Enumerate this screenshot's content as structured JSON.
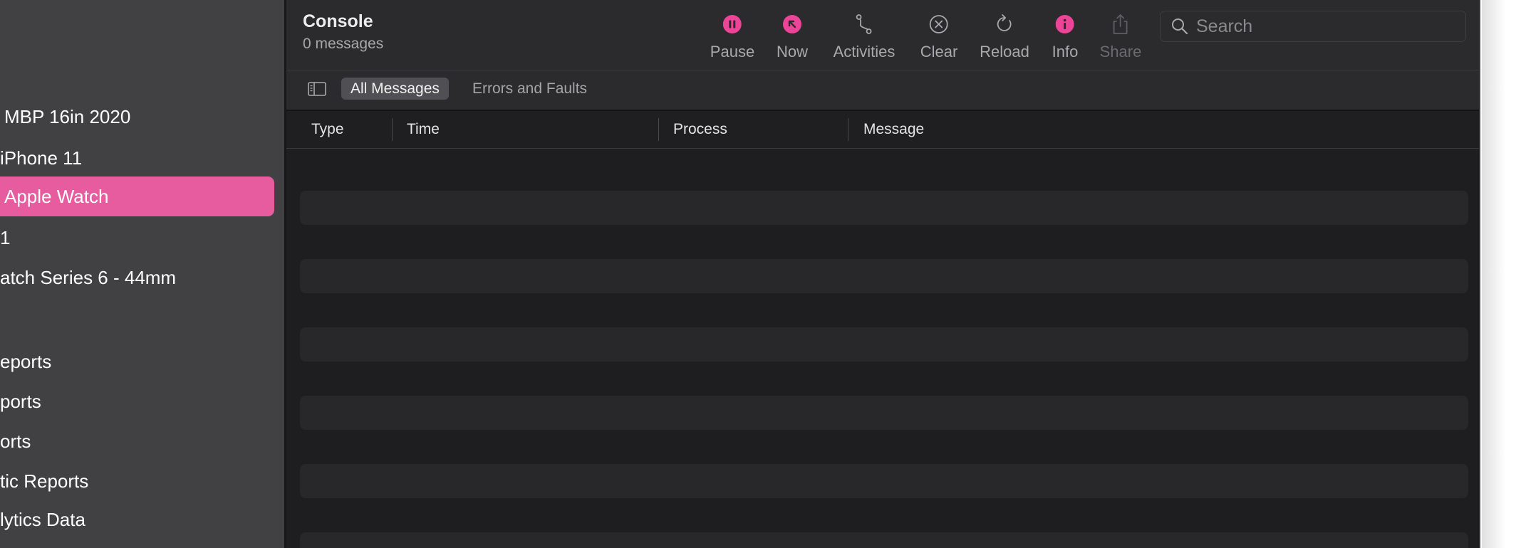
{
  "sidebar": {
    "items": [
      {
        "label": "MBP 16in 2020",
        "selected": false
      },
      {
        "label": "iPhone 11",
        "selected": false
      },
      {
        "label": "Apple Watch",
        "selected": true
      },
      {
        "label": "1",
        "selected": false
      },
      {
        "label": "atch Series 6 - 44mm",
        "selected": false
      },
      {
        "label": "eports",
        "selected": false
      },
      {
        "label": "ports",
        "selected": false
      },
      {
        "label": "orts",
        "selected": false
      },
      {
        "label": "tic Reports",
        "selected": false
      },
      {
        "label": "lytics Data",
        "selected": false
      }
    ]
  },
  "header": {
    "title": "Console",
    "subtitle": "0 messages"
  },
  "toolbar": {
    "pause_label": "Pause",
    "now_label": "Now",
    "activities_label": "Activities",
    "clear_label": "Clear",
    "reload_label": "Reload",
    "info_label": "Info",
    "share_label": "Share",
    "search_placeholder": "Search"
  },
  "filters": {
    "tabs": [
      {
        "label": "All Messages",
        "active": true
      },
      {
        "label": "Errors and Faults",
        "active": false
      }
    ]
  },
  "table": {
    "columns": [
      "Type",
      "Time",
      "Process",
      "Message"
    ],
    "rows": []
  },
  "colors": {
    "accent": "#ec4496",
    "selected_row": "#e75c9e",
    "sidebar_bg": "#414144",
    "main_bg": "#1e1e21",
    "toolbar_bg": "#2b2b2e"
  }
}
